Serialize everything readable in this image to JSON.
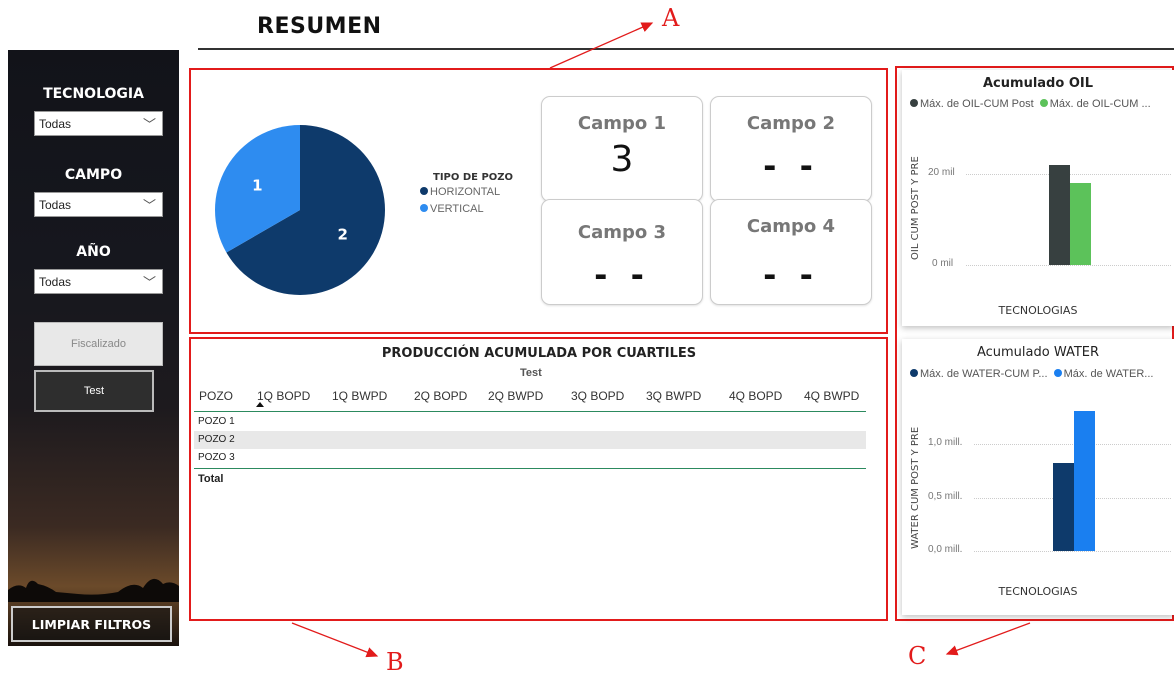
{
  "header": {
    "title": "RESUMEN"
  },
  "annotations": {
    "a": "A",
    "b": "B",
    "c": "C"
  },
  "colors": {
    "accent_red": "#e21b1b",
    "horizontal": "#0e3a6b",
    "vertical": "#2e8cf0",
    "oil_post": "#374040",
    "oil_pre": "#5cc25a",
    "water_post": "#0e3a6b",
    "water_pre": "#1a7ff0"
  },
  "sidebar": {
    "filters": [
      {
        "label": "TECNOLOGIA",
        "value": "Todas"
      },
      {
        "label": "CAMPO",
        "value": "Todas"
      },
      {
        "label": "AÑO",
        "value": "Todas"
      }
    ],
    "buttons": {
      "fiscalizado": "Fiscalizado",
      "test": "Test",
      "clear": "LIMPIAR FILTROS"
    }
  },
  "pie": {
    "legend_title": "TIPO DE POZO",
    "legend": [
      "HORIZONTAL",
      "VERTICAL"
    ],
    "slices": [
      {
        "name": "HORIZONTAL",
        "value": 2,
        "label": "2"
      },
      {
        "name": "VERTICAL",
        "value": 1,
        "label": "1"
      }
    ]
  },
  "cards": [
    {
      "label": "Campo 1",
      "value": "3"
    },
    {
      "label": "Campo 2",
      "value": "- -"
    },
    {
      "label": "Campo 3",
      "value": "- -"
    },
    {
      "label": "Campo 4",
      "value": "- -"
    }
  ],
  "table": {
    "title": "PRODUCCIÓN ACUMULADA POR CUARTILES",
    "subtitle": "Test",
    "columns": [
      "POZO",
      "1Q BOPD",
      "1Q BWPD",
      "2Q BOPD",
      "2Q BWPD",
      "3Q BOPD",
      "3Q BWPD",
      "4Q BOPD",
      "4Q BWPD"
    ],
    "rows": [
      "POZO 1",
      "POZO 2",
      "POZO 3"
    ],
    "total": "Total"
  },
  "oil_chart": {
    "title": "Acumulado OIL",
    "legend": [
      "Máx. de OIL-CUM Post",
      "Máx. de OIL-CUM ..."
    ],
    "ylabel": "OIL CUM POST Y PRE",
    "xlabel": "TECNOLOGIAS",
    "ticks": [
      "20 mil",
      "0 mil"
    ]
  },
  "water_chart": {
    "title": "Acumulado WATER",
    "legend": [
      "Máx. de WATER-CUM P...",
      "Máx. de WATER..."
    ],
    "ylabel": "WATER CUM POST Y PRE",
    "xlabel": "TECNOLOGIAS",
    "ticks": [
      "1,0 mill.",
      "0,5 mill.",
      "0,0 mill."
    ]
  },
  "chart_data": [
    {
      "type": "pie",
      "categories": [
        "HORIZONTAL",
        "VERTICAL"
      ],
      "values": [
        2,
        1
      ]
    },
    {
      "type": "bar",
      "title": "Acumulado OIL",
      "xlabel": "TECNOLOGIAS",
      "ylabel": "OIL CUM POST Y PRE",
      "categories": [
        ""
      ],
      "series": [
        {
          "name": "Máx. de OIL-CUM Post",
          "values": [
            22000
          ]
        },
        {
          "name": "Máx. de OIL-CUM ...",
          "values": [
            18000
          ]
        }
      ],
      "ylim": [
        0,
        30000
      ]
    },
    {
      "type": "bar",
      "title": "Acumulado WATER",
      "xlabel": "TECNOLOGIAS",
      "ylabel": "WATER CUM POST Y PRE",
      "categories": [
        ""
      ],
      "series": [
        {
          "name": "Máx. de WATER-CUM P...",
          "values": [
            820000
          ]
        },
        {
          "name": "Máx. de WATER...",
          "values": [
            1310000
          ]
        }
      ],
      "ylim": [
        0,
        1500000
      ]
    }
  ]
}
